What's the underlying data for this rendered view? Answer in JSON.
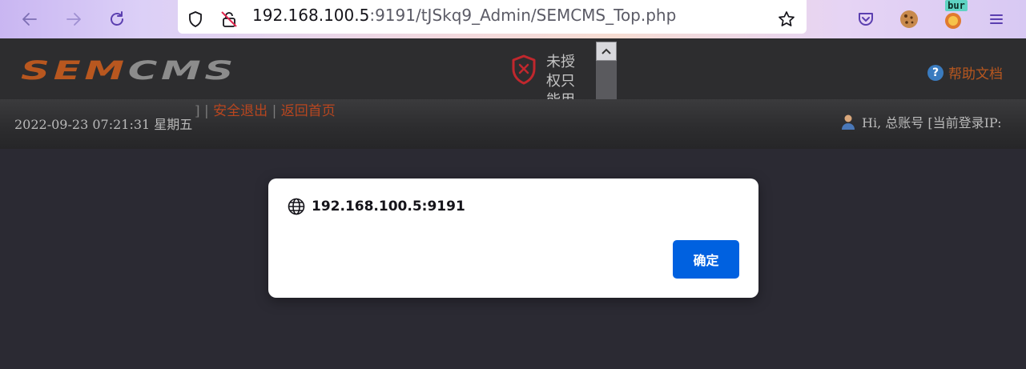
{
  "browser": {
    "url_host": "192.168.100.5",
    "url_rest": ":9191/tJSkq9_Admin/SEMCMS_Top.php",
    "extension_badge": "bur",
    "icons": [
      "back-arrow-icon",
      "forward-arrow-icon",
      "reload-icon",
      "shield-icon",
      "lock-insecure-icon",
      "star-icon",
      "pocket-icon",
      "cookie-icon",
      "extension-icon",
      "menu-icon"
    ]
  },
  "page": {
    "logo_text": "SEMCMS",
    "help_label": "帮助文档",
    "notice_text": "未授权只能用于测试",
    "datetime": "2022-09-23 07:21:31 星期五",
    "links": {
      "separator_lead": "] |",
      "logout": "安全退出",
      "separator": "|",
      "home": "返回首页"
    },
    "user_text": "Hi, 总账号 [当前登录IP:",
    "colors": {
      "brand_orange": "#b8571f",
      "brand_gray": "#8c8c8c",
      "link": "#b8461f"
    }
  },
  "dialog": {
    "origin": "192.168.100.5:9191",
    "ok_label": "确定",
    "ok_color": "#0061e0"
  }
}
